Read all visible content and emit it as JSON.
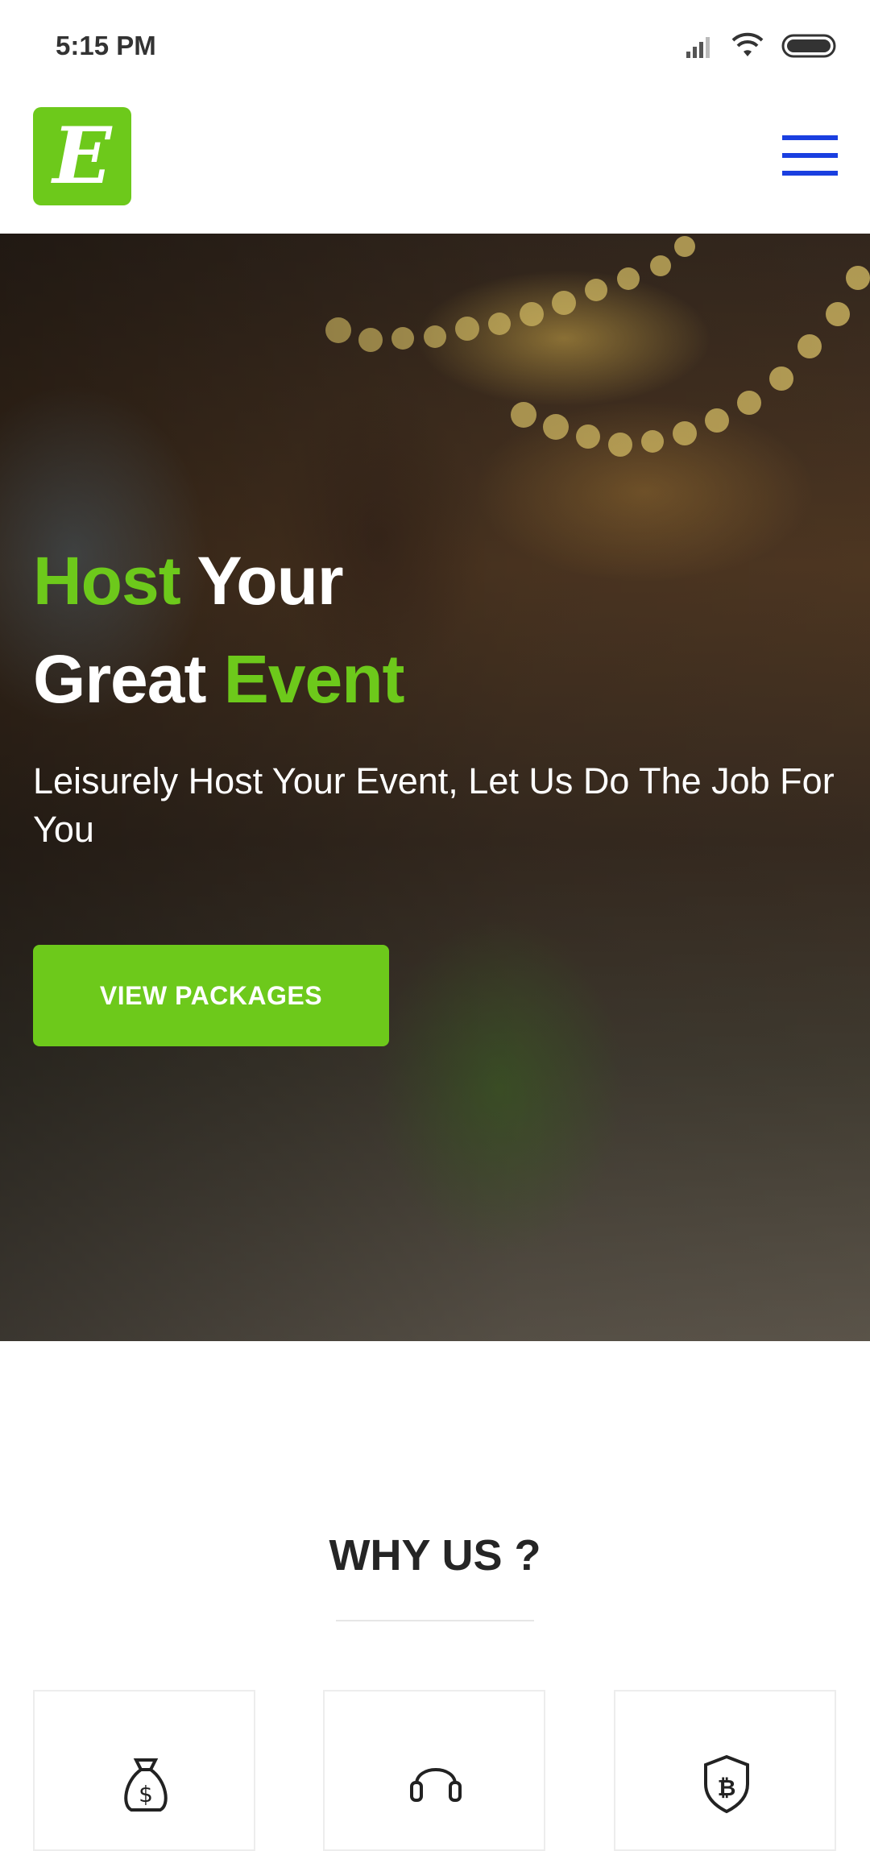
{
  "status_bar": {
    "time": "5:15 PM",
    "icons": [
      "signal-icon",
      "wifi-icon",
      "battery-icon"
    ]
  },
  "header": {
    "logo_letter": "E",
    "menu_icon": "hamburger-menu-icon",
    "colors": {
      "brand_green": "#6dc91b",
      "menu_blue": "#1a3fe0"
    }
  },
  "hero": {
    "title_word1": "Host",
    "title_word2": "Your",
    "title_word3": "Great",
    "title_word4": "Event",
    "subtitle": "Leisurely Host Your Event, Let Us Do The Job For You",
    "button_label": "VIEW PACKAGES"
  },
  "why_us": {
    "title": "WHY US ?",
    "cards": [
      {
        "icon": "money-bag-icon"
      },
      {
        "icon": "headset-icon"
      },
      {
        "icon": "bitcoin-shield-icon"
      }
    ]
  }
}
